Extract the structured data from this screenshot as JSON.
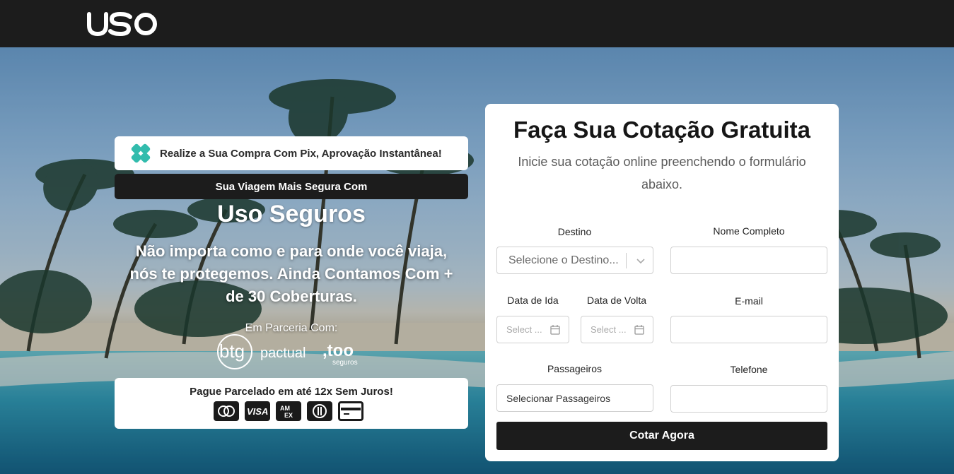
{
  "header": {
    "logo_text": "uso"
  },
  "promo": {
    "pix_text": "Realize a Sua Compra Com Pix, Aprovação Instantânea!",
    "dark_bar_text": "Sua Viagem Mais Segura Com",
    "brand_title": "Uso Seguros",
    "subtitle_line1": "Não importa como e para onde você viaja,",
    "subtitle_line2": "nós te protegemos. Ainda Contamos Com +",
    "subtitle_line3": "de 30 Coberturas.",
    "partner_label": "Em Parceria Com:",
    "partners": [
      "btg pactual",
      ",too seguros"
    ],
    "payment_text": "Pague Parcelado em até 12x Sem Juros!",
    "card_icons": [
      "mastercard-icon",
      "visa-icon",
      "amex-icon",
      "diners-icon",
      "credit-card-icon"
    ]
  },
  "form": {
    "title": "Faça Sua Cotação Gratuita",
    "description": "Inicie sua cotação online preenchendo o formulário abaixo.",
    "destino_label": "Destino",
    "destino_placeholder": "Selecione o Destino...",
    "nome_label": "Nome Completo",
    "nome_value": "",
    "ida_label": "Data de Ida",
    "ida_placeholder": "Select ...",
    "volta_label": "Data de Volta",
    "volta_placeholder": "Select ...",
    "email_label": "E-mail",
    "email_value": "",
    "passageiros_label": "Passageiros",
    "passageiros_value": "Selecionar Passageiros",
    "telefone_label": "Telefone",
    "telefone_value": "",
    "submit_label": "Cotar Agora"
  },
  "colors": {
    "topbar": "#1c1c1c",
    "dark_button": "#1c1c1c",
    "pix_green": "#32bcad"
  }
}
